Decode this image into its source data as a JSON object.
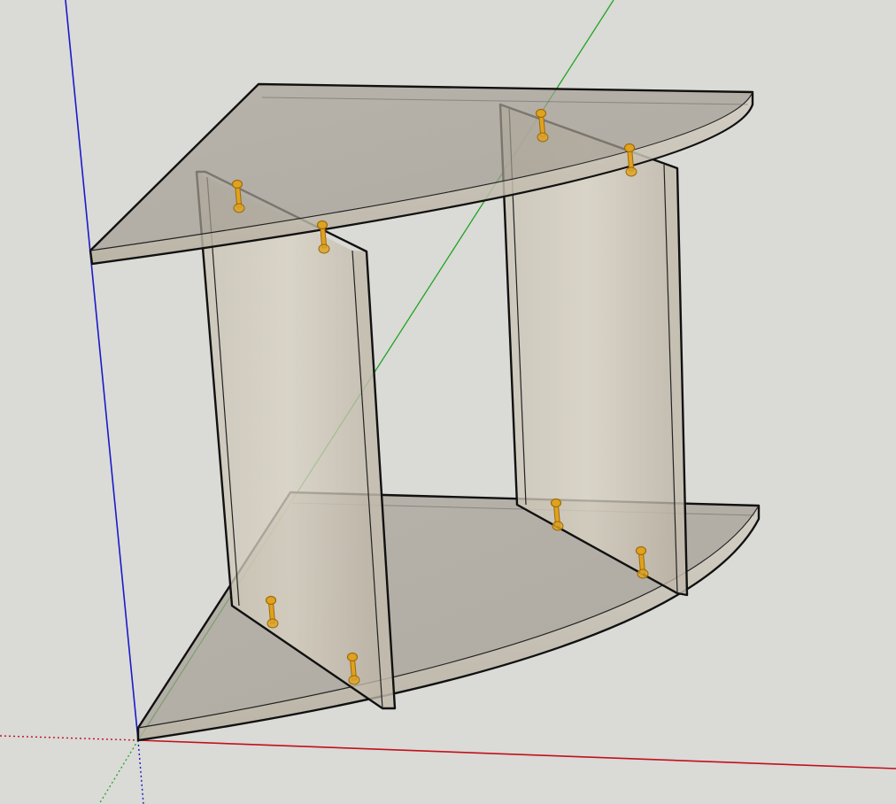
{
  "app": {
    "kind": "3d-modeling-viewport"
  },
  "model": {
    "description_shown": "",
    "components": [
      {
        "id": "top-shelf",
        "type": "quarter-round-shelf"
      },
      {
        "id": "bottom-shelf",
        "type": "quarter-round-shelf"
      },
      {
        "id": "left-side-panel",
        "type": "vertical-panel"
      },
      {
        "id": "right-side-panel",
        "type": "vertical-panel"
      }
    ],
    "hardware": {
      "type": "cam-lock-fittings",
      "count": 8
    }
  },
  "axes": {
    "red": "#c0111a",
    "green": "#1fa51f",
    "blue": "#1a1ac8"
  },
  "colors": {
    "background": "#dadad7",
    "panel_fill": "#b9b1a4",
    "shelf_fill": "#a49f96",
    "edge": "#111111",
    "hardware": "#e0a21f",
    "hardware_dark": "#9c6a09"
  }
}
